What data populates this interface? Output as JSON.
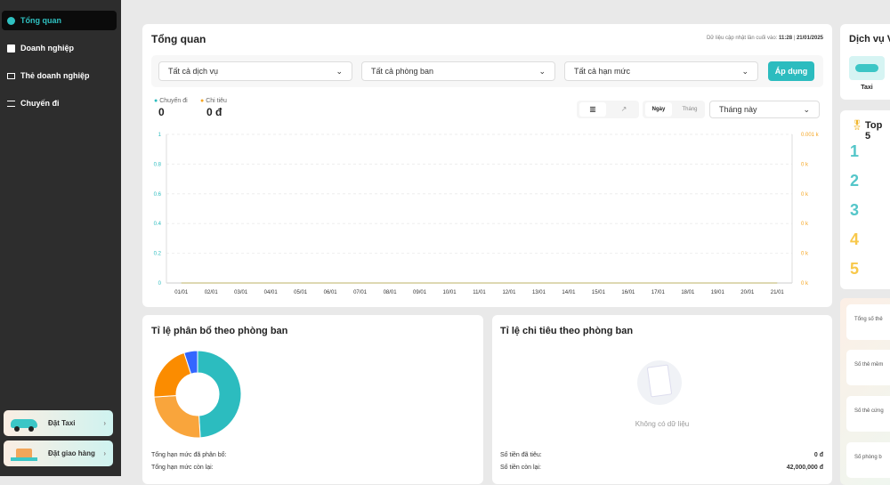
{
  "sidebar": {
    "items": [
      {
        "label": "Tổng quan",
        "icon": "pie-chart-icon",
        "active": true
      },
      {
        "label": "Doanh nghiệp",
        "icon": "briefcase-icon"
      },
      {
        "label": "Thẻ doanh nghiệp",
        "icon": "id-card-icon"
      },
      {
        "label": "Chuyến đi",
        "icon": "route-icon"
      }
    ],
    "promos": [
      {
        "label": "Đặt Taxi",
        "icon": "taxi-car-icon",
        "arrow": "›"
      },
      {
        "label": "Đặt giao hàng",
        "icon": "delivery-boxes-icon",
        "arrow": "›"
      }
    ]
  },
  "overview": {
    "title": "Tổng quan",
    "updated_prefix": "Dữ liệu cập nhật lần cuối vào:",
    "updated_time": "11:28",
    "updated_sep": "|",
    "updated_date": "21/01/2025",
    "filters": {
      "service": "Tất cả dịch vụ",
      "department": "Tất cả phòng ban",
      "limit": "Tất cả hạn mức",
      "apply": "Áp dụng"
    },
    "stats": [
      {
        "label": "Chuyến đi",
        "value": "0",
        "color": "#2cbcbf"
      },
      {
        "label": "Chi tiêu",
        "value": "0 đ",
        "color": "#f5a623"
      }
    ],
    "view_toggle": {
      "day": "Ngày",
      "month": "Tháng",
      "active": "Ngày"
    },
    "period": "Tháng này"
  },
  "chart_data": {
    "type": "line",
    "categories": [
      "01/01",
      "02/01",
      "03/01",
      "04/01",
      "05/01",
      "06/01",
      "07/01",
      "08/01",
      "09/01",
      "10/01",
      "11/01",
      "12/01",
      "13/01",
      "14/01",
      "15/01",
      "16/01",
      "17/01",
      "18/01",
      "19/01",
      "20/01",
      "21/01"
    ],
    "left_ticks": [
      "0",
      "0.2",
      "0.4",
      "0.6",
      "0.8",
      "1"
    ],
    "right_ticks": [
      "0 k",
      "0 k",
      "0 k",
      "0 k",
      "0 k",
      "0.001 k"
    ],
    "ylim": [
      0,
      1
    ],
    "grid": true,
    "series": [
      {
        "values": [
          0,
          0,
          0,
          0,
          0,
          0,
          0,
          0,
          0,
          0,
          0,
          0,
          0,
          0,
          0,
          0,
          0,
          0,
          0,
          0,
          0
        ],
        "color": "#2cbcbf"
      },
      {
        "values": [
          0,
          0,
          0,
          0,
          0,
          0,
          0,
          0,
          0,
          0,
          0,
          0,
          0,
          0,
          0,
          0,
          0,
          0,
          0,
          0,
          0
        ],
        "color": "#f5a623"
      }
    ]
  },
  "dept_alloc": {
    "title": "Tỉ lệ phân bổ theo phòng ban",
    "donut": [
      {
        "percent": 49,
        "color": "#2cbcbf"
      },
      {
        "percent": 25,
        "color": "#f9a53c"
      },
      {
        "percent": 21,
        "color": "#fb8c00"
      },
      {
        "percent": 5,
        "color": "#3366ff"
      }
    ],
    "rows": [
      {
        "label": "Tổng hạn mức đã phân bổ:"
      },
      {
        "label": "Tổng hạn mức còn lại:"
      }
    ]
  },
  "dept_spend": {
    "title": "Tỉ lệ chi tiêu theo phòng ban",
    "empty": "Không có dữ liệu",
    "rows": [
      {
        "label": "Số tiền đã tiêu:",
        "value": "0 đ"
      },
      {
        "label": "Số tiền còn lại:",
        "value": "42,000,000 đ"
      }
    ]
  },
  "services": {
    "title": "Dịch vụ V",
    "items": [
      {
        "label": "Taxi"
      }
    ]
  },
  "top5": {
    "title": "Top 5",
    "ranks": [
      "1",
      "2",
      "3",
      "4",
      "5"
    ]
  },
  "summary": [
    "Tổng số thẻ",
    "Số thẻ mềm",
    "Số thẻ cứng",
    "Số phòng b"
  ]
}
